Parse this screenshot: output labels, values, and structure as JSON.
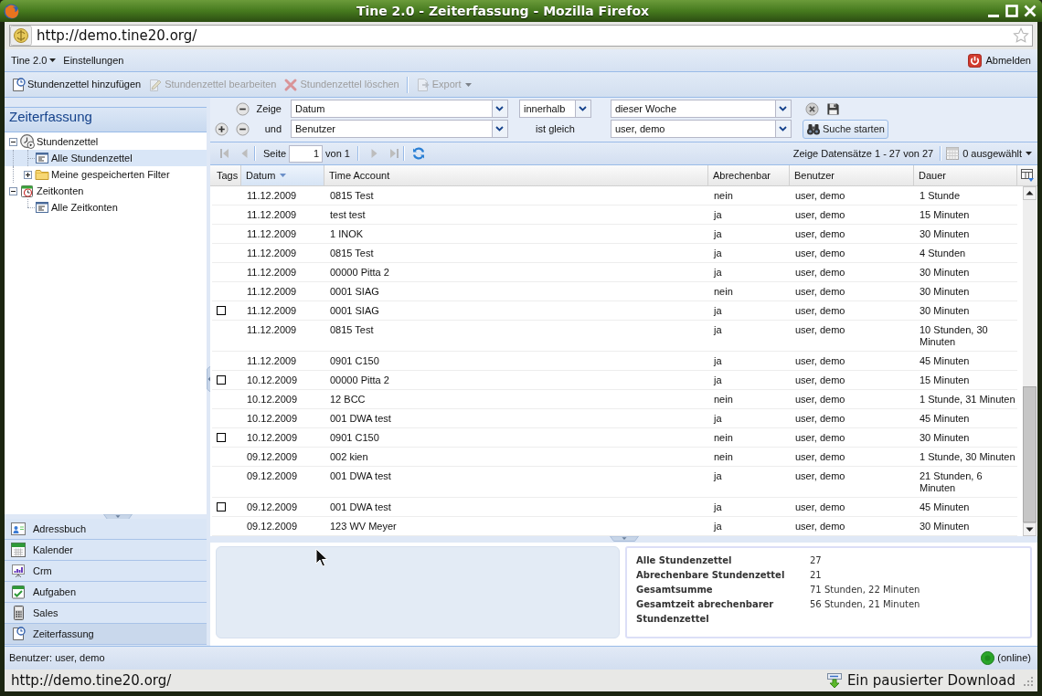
{
  "window": {
    "title": "Tine 2.0 - Zeiterfassung - Mozilla Firefox"
  },
  "address_bar": {
    "url": "http://demo.tine20.org/"
  },
  "menu_bar": {
    "items": [
      {
        "label": "Tine 2.0",
        "dropdown": true
      },
      {
        "label": "Einstellungen",
        "dropdown": false
      }
    ],
    "logout": "Abmelden"
  },
  "toolbar": {
    "buttons": [
      {
        "label": "Stundenzettel hinzufügen",
        "disabled": false,
        "dropdown": false
      },
      {
        "label": "Stundenzettel bearbeiten",
        "disabled": true,
        "dropdown": false
      },
      {
        "label": "Stundenzettel löschen",
        "disabled": true,
        "dropdown": false
      },
      {
        "label": "Export",
        "disabled": true,
        "dropdown": true
      }
    ]
  },
  "sidebar": {
    "title": "Zeiterfassung",
    "tree": [
      {
        "label": "Stundenzettel",
        "kind": "timesheets",
        "expanded": true,
        "selected": false,
        "children": [
          {
            "label": "Alle Stundenzettel",
            "kind": "list",
            "selected": true
          },
          {
            "label": "Meine gespeicherten Filter",
            "kind": "folder",
            "expanded": false,
            "selected": false
          }
        ]
      },
      {
        "label": "Zeitkonten",
        "kind": "accounts",
        "expanded": true,
        "selected": false,
        "children": [
          {
            "label": "Alle Zeitkonten",
            "kind": "list",
            "selected": false
          }
        ]
      }
    ],
    "apps": [
      {
        "label": "Adressbuch",
        "selected": false
      },
      {
        "label": "Kalender",
        "selected": false
      },
      {
        "label": "Crm",
        "selected": false
      },
      {
        "label": "Aufgaben",
        "selected": false
      },
      {
        "label": "Sales",
        "selected": false
      },
      {
        "label": "Zeiterfassung",
        "selected": true
      }
    ]
  },
  "filter": {
    "rows": [
      {
        "connector": "Zeige",
        "field": "Datum",
        "operator": {
          "kind": "combo",
          "text": "innerhalb"
        },
        "value": "dieser Woche",
        "add_button": false
      },
      {
        "connector": "und",
        "field": "Benutzer",
        "operator": {
          "kind": "label",
          "text": "ist gleich"
        },
        "value": "user, demo",
        "add_button": true
      }
    ],
    "search_button": "Suche starten"
  },
  "paging": {
    "page_label": "Seite",
    "page": "1",
    "page_count": "von 1",
    "display_info": "Zeige Datensätze 1 - 27 von 27",
    "selection": "0 ausgewählt"
  },
  "table": {
    "columns": [
      {
        "label": "Tags",
        "sorted": false
      },
      {
        "label": "Datum",
        "sorted": true
      },
      {
        "label": "Time Account",
        "sorted": false
      },
      {
        "label": "Abrechenbar",
        "sorted": false
      },
      {
        "label": "Benutzer",
        "sorted": false
      },
      {
        "label": "Dauer",
        "sorted": false
      }
    ],
    "rows": [
      {
        "tagged": false,
        "date": "11.12.2009",
        "time_account": "0815 Test",
        "billable": "nein",
        "user": "user, demo",
        "duration": "1 Stunde"
      },
      {
        "tagged": false,
        "date": "11.12.2009",
        "time_account": "test test",
        "billable": "ja",
        "user": "user, demo",
        "duration": "15 Minuten"
      },
      {
        "tagged": false,
        "date": "11.12.2009",
        "time_account": "1 INOK",
        "billable": "ja",
        "user": "user, demo",
        "duration": "30 Minuten"
      },
      {
        "tagged": false,
        "date": "11.12.2009",
        "time_account": "0815 Test",
        "billable": "ja",
        "user": "user, demo",
        "duration": "4 Stunden"
      },
      {
        "tagged": false,
        "date": "11.12.2009",
        "time_account": "00000 Pitta 2",
        "billable": "ja",
        "user": "user, demo",
        "duration": "30 Minuten"
      },
      {
        "tagged": false,
        "date": "11.12.2009",
        "time_account": "0001 SIAG",
        "billable": "nein",
        "user": "user, demo",
        "duration": "30 Minuten"
      },
      {
        "tagged": true,
        "date": "11.12.2009",
        "time_account": "0001 SIAG",
        "billable": "ja",
        "user": "user, demo",
        "duration": "30 Minuten"
      },
      {
        "tagged": false,
        "date": "11.12.2009",
        "time_account": "0815 Test",
        "billable": "ja",
        "user": "user, demo",
        "duration": "10 Stunden, 30 Minuten"
      },
      {
        "tagged": false,
        "date": "11.12.2009",
        "time_account": "0901 C150",
        "billable": "ja",
        "user": "user, demo",
        "duration": "45 Minuten"
      },
      {
        "tagged": true,
        "date": "10.12.2009",
        "time_account": "00000 Pitta 2",
        "billable": "ja",
        "user": "user, demo",
        "duration": "15 Minuten"
      },
      {
        "tagged": false,
        "date": "10.12.2009",
        "time_account": "12 BCC",
        "billable": "nein",
        "user": "user, demo",
        "duration": "1 Stunde, 31 Minuten"
      },
      {
        "tagged": false,
        "date": "10.12.2009",
        "time_account": "001 DWA test",
        "billable": "ja",
        "user": "user, demo",
        "duration": "45 Minuten"
      },
      {
        "tagged": true,
        "date": "10.12.2009",
        "time_account": "0901 C150",
        "billable": "nein",
        "user": "user, demo",
        "duration": "30 Minuten"
      },
      {
        "tagged": false,
        "date": "09.12.2009",
        "time_account": "002 kien",
        "billable": "nein",
        "user": "user, demo",
        "duration": "1 Stunde, 30 Minuten"
      },
      {
        "tagged": false,
        "date": "09.12.2009",
        "time_account": "001 DWA test",
        "billable": "ja",
        "user": "user, demo",
        "duration": "21 Stunden, 6 Minuten"
      },
      {
        "tagged": true,
        "date": "09.12.2009",
        "time_account": "001 DWA test",
        "billable": "ja",
        "user": "user, demo",
        "duration": "45 Minuten"
      },
      {
        "tagged": false,
        "date": "09.12.2009",
        "time_account": "123 WV Meyer",
        "billable": "ja",
        "user": "user, demo",
        "duration": "30 Minuten"
      }
    ]
  },
  "summary": {
    "rows": [
      {
        "label": "Alle Stundenzettel",
        "value": "27"
      },
      {
        "label": "Abrechenbare Stundenzettel",
        "value": "21"
      },
      {
        "label": "Gesamtsumme",
        "value": "71 Stunden, 22 Minuten"
      },
      {
        "label": "Gesamtzeit abrechenbarer Stundenzettel",
        "value": "56 Stunden, 21 Minuten"
      }
    ]
  },
  "status_bar": {
    "user": "Benutzer: user, demo",
    "connection": {
      "text": "(online)",
      "online": true
    }
  },
  "browser_status": {
    "url": "http://demo.tine20.org/",
    "downloads": "Ein pausierter Download"
  }
}
